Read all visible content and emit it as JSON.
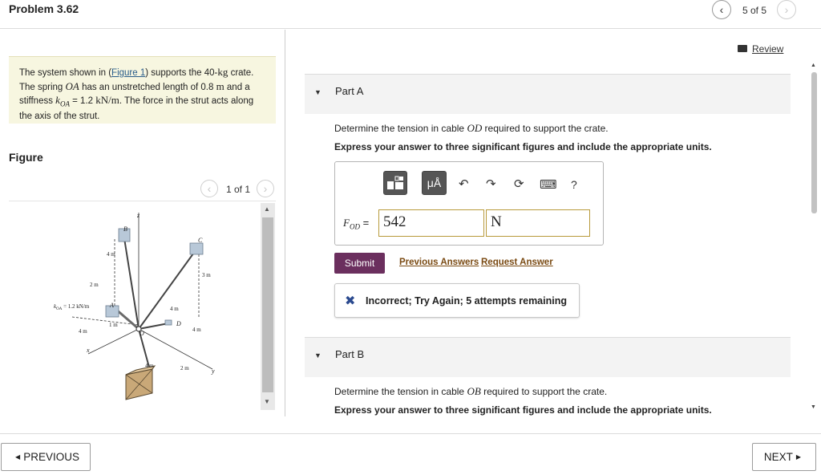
{
  "header": {
    "title": "Problem 3.62",
    "pager": "5 of 5",
    "prev_icon": "‹",
    "next_icon": "›"
  },
  "review": {
    "label": "Review"
  },
  "intro": {
    "t1": "The system shown in (",
    "figure_link": "Figure 1",
    "t2": ") supports the 40-",
    "kg": "kg",
    "t3": " crate. The spring ",
    "oa": "OA",
    "t4": " has an unstretched length of 0.8 ",
    "m": "m",
    "t5": " and a stiffness ",
    "k": "k",
    "k_sub": "OA",
    "t6": " = 1.2 ",
    "knm": "kN/m",
    "t7": ". The force in the strut acts along the axis of the strut."
  },
  "figure": {
    "label": "Figure",
    "pager": "1 of 1",
    "labels": {
      "z": "z",
      "B": "B",
      "C": "C",
      "4m_top": "4 m",
      "3m": "3 m",
      "2m_left": "2 m",
      "k": "k",
      "k_sub": "OA",
      "k_val": " = 1.2 kN/m",
      "A": "A",
      "1m": "1 m",
      "4m_mid": "4 m",
      "D": "D",
      "4m_left": "4 m",
      "O": "O",
      "4m_right": "4 m",
      "x": "x",
      "4m_bottom": "4 m",
      "2m_bottom": "2 m",
      "y": "y"
    }
  },
  "partA": {
    "title": "Part A",
    "q1_a": "Determine the tension in cable ",
    "q1_var": "OD",
    "q1_b": " required to support the crate.",
    "q2": "Express your answer to three significant figures and include the appropriate units.",
    "toolbar": {
      "templates_icon": "templates-icon",
      "units_label": "μÅ",
      "undo": "↶",
      "redo": "↷",
      "reset": "⟳",
      "keyboard": "⌨",
      "help": "?"
    },
    "var_label": "F",
    "var_sub": "OD",
    "equals": " =",
    "answer_value": "542",
    "answer_unit": "N",
    "submit": "Submit",
    "prev_answers": "Previous Answers",
    "request_answer": "Request Answer",
    "feedback_icon": "✖",
    "feedback": "Incorrect; Try Again; 5 attempts remaining"
  },
  "partB": {
    "title": "Part B",
    "q1_a": "Determine the tension in cable ",
    "q1_var": "OB",
    "q1_b": " required to support the crate.",
    "q2": "Express your answer to three significant figures and include the appropriate units."
  },
  "footer": {
    "prev": "PREVIOUS",
    "next": "NEXT"
  },
  "colors": {
    "submit_bg": "#6b2f5e",
    "link": "#7a4a12",
    "intro_bg": "#f7f6e0",
    "input_border": "#b89a3c",
    "incorrect_icon": "#2b4a8f"
  }
}
